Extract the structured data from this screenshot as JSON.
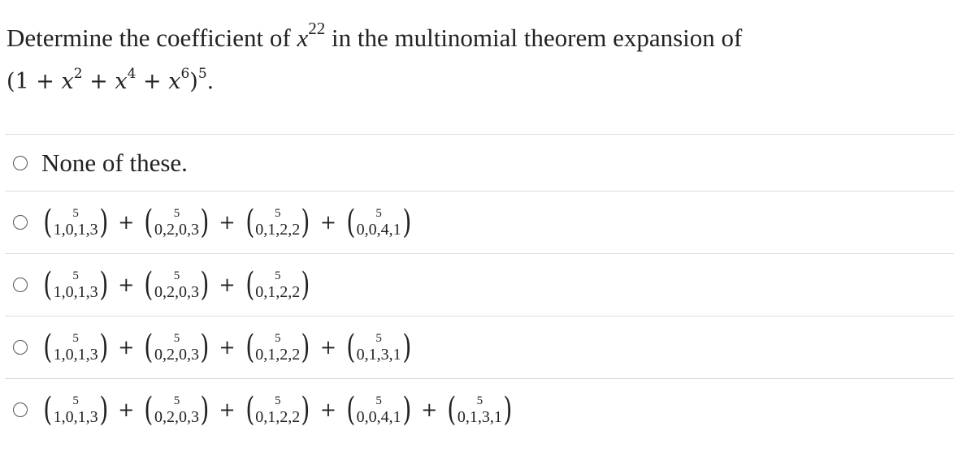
{
  "question": {
    "line1_prefix": "Determine the coefficient of ",
    "var": "x",
    "exponent": "22",
    "line1_suffix": " in the multinomial theorem expansion of",
    "polynomial": {
      "open": "(1 + ",
      "terms": [
        {
          "var": "x",
          "exp": "2",
          "sep": " + "
        },
        {
          "var": "x",
          "exp": "4",
          "sep": " + "
        },
        {
          "var": "x",
          "exp": "6",
          "sep": ""
        }
      ],
      "close": ")",
      "outer_exp": "5",
      "period": "."
    }
  },
  "options": [
    {
      "label": "None of these."
    },
    {
      "terms": [
        {
          "top": "5",
          "bottom": "1,0,1,3"
        },
        {
          "top": "5",
          "bottom": "0,2,0,3"
        },
        {
          "top": "5",
          "bottom": "0,1,2,2"
        },
        {
          "top": "5",
          "bottom": "0,0,4,1"
        }
      ]
    },
    {
      "terms": [
        {
          "top": "5",
          "bottom": "1,0,1,3"
        },
        {
          "top": "5",
          "bottom": "0,2,0,3"
        },
        {
          "top": "5",
          "bottom": "0,1,2,2"
        }
      ]
    },
    {
      "terms": [
        {
          "top": "5",
          "bottom": "1,0,1,3"
        },
        {
          "top": "5",
          "bottom": "0,2,0,3"
        },
        {
          "top": "5",
          "bottom": "0,1,2,2"
        },
        {
          "top": "5",
          "bottom": "0,1,3,1"
        }
      ]
    },
    {
      "terms": [
        {
          "top": "5",
          "bottom": "1,0,1,3"
        },
        {
          "top": "5",
          "bottom": "0,2,0,3"
        },
        {
          "top": "5",
          "bottom": "0,1,2,2"
        },
        {
          "top": "5",
          "bottom": "0,0,4,1"
        },
        {
          "top": "5",
          "bottom": "0,1,3,1"
        }
      ]
    }
  ],
  "symbols": {
    "plus": "+",
    "left_paren": "(",
    "right_paren": ")"
  },
  "colors": {
    "text": "#222222",
    "divider": "#dcdcdc",
    "radio_border": "#555555"
  }
}
